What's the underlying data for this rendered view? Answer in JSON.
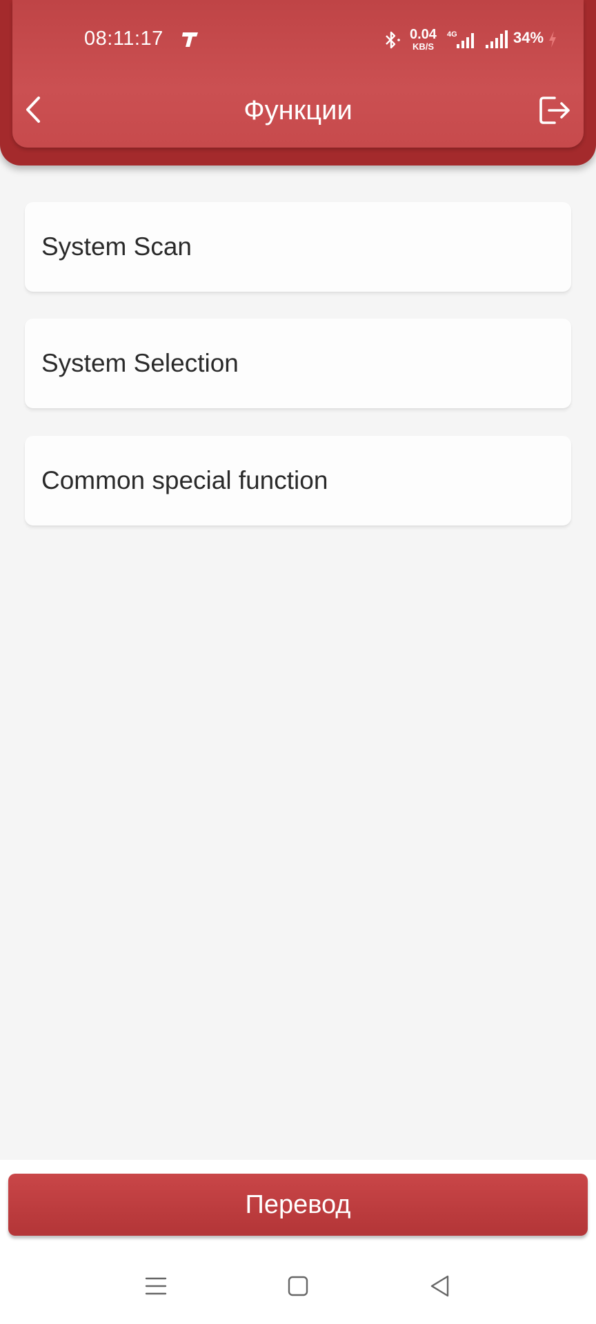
{
  "status_bar": {
    "time": "08:11:17",
    "net_speed_value": "0.04",
    "net_speed_unit": "KB/S",
    "network_type": "4G",
    "battery": "34%"
  },
  "header": {
    "title": "Функции",
    "back_icon": "chevron-left-icon",
    "exit_icon": "exit-icon"
  },
  "menu": {
    "items": [
      {
        "label": "System Scan"
      },
      {
        "label": "System Selection"
      },
      {
        "label": "Common special function"
      }
    ]
  },
  "footer": {
    "translate_label": "Перевод"
  },
  "colors": {
    "header_red": "#c74a4c",
    "header_dark": "#a42a2c",
    "button_red": "#b33537",
    "background": "#f5f5f5"
  }
}
